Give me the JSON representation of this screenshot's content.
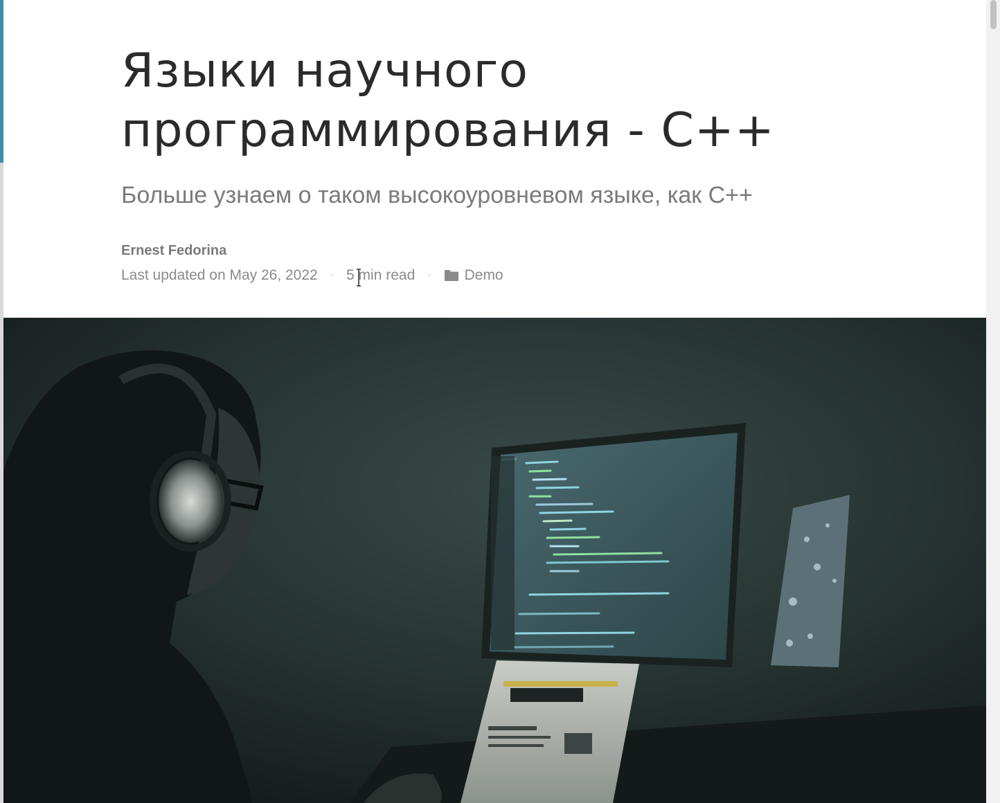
{
  "article": {
    "title": "Языки научного программирования - C++",
    "subtitle": "Больше узнаем о таком высокоуровневом языке, как C++",
    "author": "Ernest Fedorina",
    "last_updated": "Last updated on May 26, 2022",
    "reading_time": "5 min read",
    "category": "Demo",
    "separator": "·"
  },
  "hero_image": {
    "icon": "photo-person-at-computer"
  },
  "colors": {
    "accent_left_edge": "#3a8fb0",
    "title": "#2b2b2b",
    "subtitle": "#7a7a7a",
    "meta": "#8a8a8a"
  }
}
